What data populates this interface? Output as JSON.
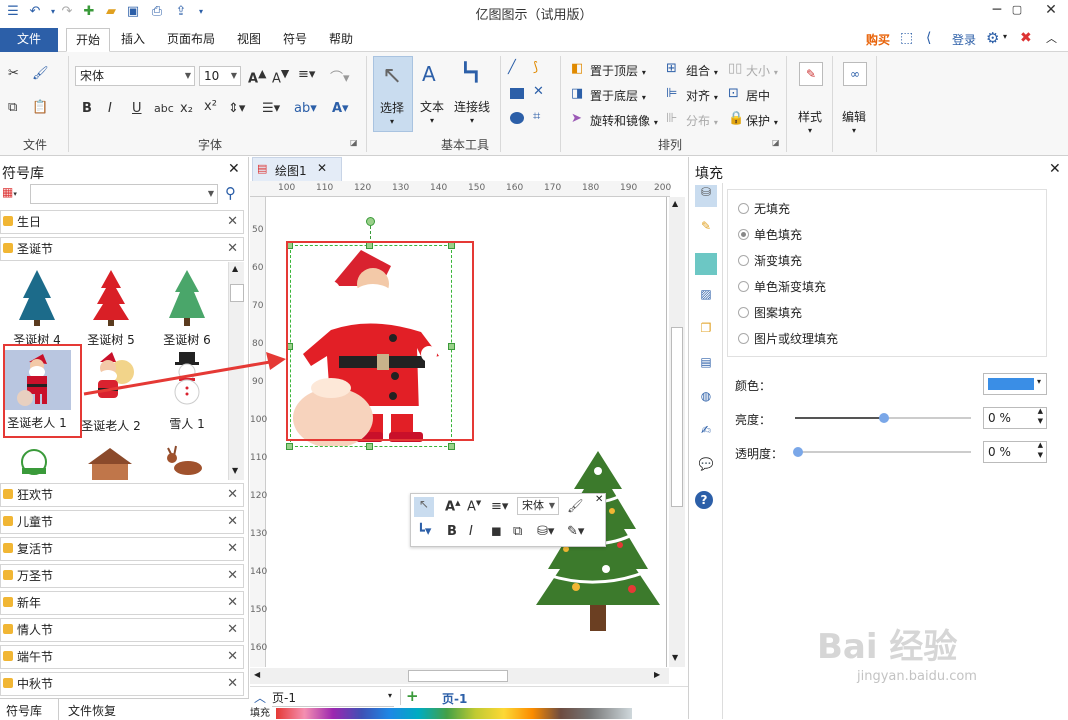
{
  "window": {
    "title": "亿图图示（试用版）"
  },
  "menu": {
    "tabs": [
      "文件",
      "开始",
      "插入",
      "页面布局",
      "视图",
      "符号",
      "帮助"
    ],
    "right": {
      "buy": "购买",
      "login": "登录"
    }
  },
  "ribbon": {
    "groups": {
      "file": "文件",
      "font": "字体",
      "basic_tools": "基本工具",
      "arrange": "排列"
    },
    "font_name": "宋体",
    "font_size": "10",
    "tools": {
      "select": "选择",
      "text": "文本",
      "connector": "连接线"
    },
    "arrange": {
      "bring_front": "置于顶层",
      "send_back": "置于底层",
      "rotate": "旋转和镜像",
      "group": "组合",
      "align": "对齐",
      "distribute": "分布",
      "size": "大小",
      "center": "居中",
      "protect": "保护"
    },
    "style": "样式",
    "edit": "编辑"
  },
  "symbol_library": {
    "title": "符号库",
    "search_placeholder": "",
    "open_categories": [
      "生日",
      "圣诞节"
    ],
    "symbols": [
      {
        "label": "圣诞树 4",
        "icon": "tree-blue-icon"
      },
      {
        "label": "圣诞树 5",
        "icon": "tree-red-icon"
      },
      {
        "label": "圣诞树 6",
        "icon": "tree-green-icon"
      },
      {
        "label": "圣诞老人 1",
        "icon": "santa-icon"
      },
      {
        "label": "圣诞老人 2",
        "icon": "santa2-icon"
      },
      {
        "label": "雪人 1",
        "icon": "snowman-icon"
      }
    ],
    "categories": [
      "狂欢节",
      "儿童节",
      "复活节",
      "万圣节",
      "新年",
      "情人节",
      "端午节",
      "中秋节"
    ],
    "bottom_tabs": [
      "符号库",
      "文件恢复"
    ]
  },
  "document": {
    "tab": "绘图1",
    "ruler_h": [
      "100",
      "110",
      "120",
      "130",
      "140",
      "150",
      "160",
      "170",
      "180",
      "190",
      "200"
    ],
    "ruler_v": [
      "50",
      "60",
      "70",
      "80",
      "90",
      "100",
      "110",
      "120",
      "130",
      "140",
      "150",
      "160"
    ],
    "page_select": "页-1",
    "page_tab": "页-1",
    "fill_label": "填充"
  },
  "float_toolbar": {
    "font": "宋体"
  },
  "fill_panel": {
    "title": "填充",
    "options": [
      "无填充",
      "单色填充",
      "渐变填充",
      "单色渐变填充",
      "图案填充",
      "图片或纹理填充"
    ],
    "selected_index": 1,
    "color_label": "颜色：",
    "brightness_label": "亮度：",
    "brightness_value": "0 %",
    "transparency_label": "透明度：",
    "transparency_value": "0 %",
    "color": "#3a8ee6"
  },
  "watermark": {
    "text": "Bai 经验",
    "sub": "jingyan.baidu.com"
  },
  "colors": {
    "accent": "#2c5fa8",
    "selection": "#e53935",
    "buy": "#e8630a"
  }
}
